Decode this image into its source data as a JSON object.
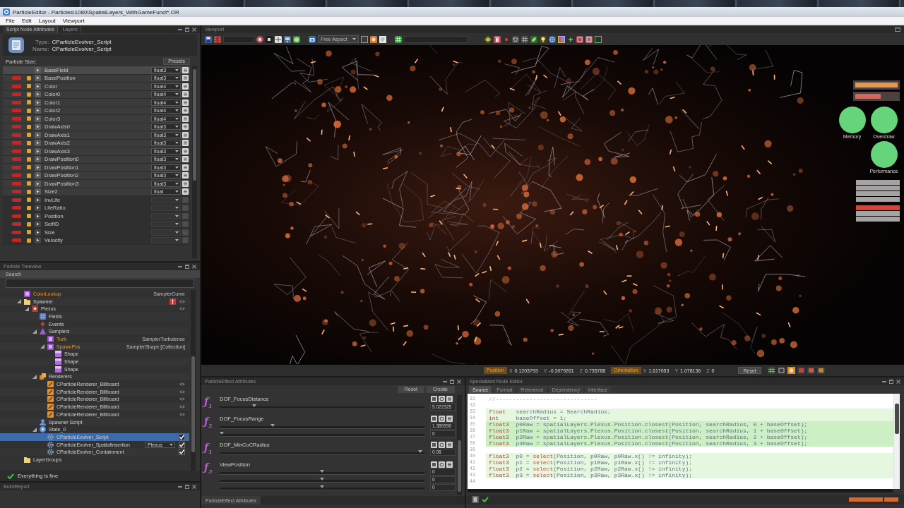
{
  "window": {
    "title": "ParticleEditor - Particles\\1080\\SpatialLayers_WithGameFunct*.OR"
  },
  "menu": [
    {
      "label": "File"
    },
    {
      "label": "Edit"
    },
    {
      "label": "Layout"
    },
    {
      "label": "Viewport"
    }
  ],
  "script_node_attributes": {
    "tabs": [
      {
        "label": "Script Node Attributes",
        "selected": true
      },
      {
        "label": "Layers",
        "selected": false
      }
    ],
    "type_label": "Type:",
    "type": "CParticleEvolver_Script",
    "name_label": "Name:",
    "name": "CParticleEvolver_Script",
    "size_label": "Particle Size:",
    "presets": "Presets",
    "fields": [
      {
        "name": "BaseField",
        "type": "float3",
        "selected": true,
        "editable": true,
        "marked": false
      },
      {
        "name": "BasePosition",
        "type": "float3",
        "selected": false,
        "editable": true,
        "marked": true
      },
      {
        "name": "Color",
        "type": "float4",
        "selected": false,
        "editable": true,
        "marked": true
      },
      {
        "name": "Color0",
        "type": "float4",
        "selected": false,
        "editable": true,
        "marked": true
      },
      {
        "name": "Color1",
        "type": "float4",
        "selected": false,
        "editable": true,
        "marked": true
      },
      {
        "name": "Color2",
        "type": "float4",
        "selected": false,
        "editable": true,
        "marked": true
      },
      {
        "name": "Color3",
        "type": "float4",
        "selected": false,
        "editable": true,
        "marked": true
      },
      {
        "name": "DrawAxis0",
        "type": "float3",
        "selected": false,
        "editable": true,
        "marked": true
      },
      {
        "name": "DrawAxis1",
        "type": "float3",
        "selected": false,
        "editable": true,
        "marked": true
      },
      {
        "name": "DrawAxis2",
        "type": "float3",
        "selected": false,
        "editable": true,
        "marked": true
      },
      {
        "name": "DrawAxis3",
        "type": "float3",
        "selected": false,
        "editable": true,
        "marked": true
      },
      {
        "name": "DrawPosition0",
        "type": "float3",
        "selected": false,
        "editable": true,
        "marked": true
      },
      {
        "name": "DrawPosition1",
        "type": "float3",
        "selected": false,
        "editable": true,
        "marked": true
      },
      {
        "name": "DrawPosition2",
        "type": "float3",
        "selected": false,
        "editable": true,
        "marked": true
      },
      {
        "name": "DrawPosition3",
        "type": "float3",
        "selected": false,
        "editable": true,
        "marked": true
      },
      {
        "name": "Size2",
        "type": "float",
        "selected": false,
        "editable": true,
        "marked": true
      },
      {
        "name": "InvLife",
        "selected": false,
        "editable": false,
        "marked": true
      },
      {
        "name": "LifeRatio",
        "selected": false,
        "editable": false,
        "marked": true
      },
      {
        "name": "Position",
        "selected": false,
        "editable": false,
        "marked": true
      },
      {
        "name": "SelfID",
        "selected": false,
        "editable": false,
        "marked": true
      },
      {
        "name": "Size",
        "selected": false,
        "editable": false,
        "marked": true
      },
      {
        "name": "Velocity",
        "selected": false,
        "editable": false,
        "marked": true
      }
    ]
  },
  "treeview": {
    "title": "Particle Treeview",
    "search_label": "Search",
    "nodes": [
      {
        "label": "ColorLookup",
        "kind": "sampler",
        "accent": true,
        "type": "SamplerCurve",
        "selected": false
      },
      {
        "label": "Spawner",
        "kind": "layer",
        "selected": false,
        "expanded": true,
        "alert": true,
        "toggle": true,
        "children": [
          {
            "label": "Plexus",
            "kind": "emitter",
            "selected": false,
            "expanded": true,
            "toggle": true,
            "children": [
              {
                "label": "Fields",
                "kind": "fields",
                "selected": false
              },
              {
                "label": "Events",
                "kind": "events",
                "selected": false
              },
              {
                "label": "Samplers",
                "kind": "samplers",
                "selected": false,
                "expanded": true,
                "children": [
                  {
                    "label": "Turb",
                    "kind": "sampler",
                    "accent": true,
                    "type": "SamplerTurbulence",
                    "selected": false
                  },
                  {
                    "label": "SpawnPos",
                    "kind": "sampler",
                    "accent": true,
                    "type": "SamplerShape [Collection]",
                    "selected": false,
                    "expanded": true,
                    "children": [
                      {
                        "label": "Shape",
                        "kind": "shape",
                        "selected": false
                      },
                      {
                        "label": "Shape",
                        "kind": "shape",
                        "selected": false
                      },
                      {
                        "label": "Shape",
                        "kind": "shape",
                        "selected": false
                      }
                    ]
                  }
                ]
              },
              {
                "label": "Renderers",
                "kind": "renderers",
                "selected": false,
                "expanded": true,
                "children": [
                  {
                    "label": "CParticleRenderer_Billboard",
                    "kind": "renderer",
                    "selected": false,
                    "toggle": true
                  },
                  {
                    "label": "CParticleRenderer_Billboard",
                    "kind": "renderer",
                    "selected": false,
                    "toggle": true
                  },
                  {
                    "label": "CParticleRenderer_Billboard",
                    "kind": "renderer",
                    "selected": false,
                    "toggle": true
                  },
                  {
                    "label": "CParticleRenderer_Billboard",
                    "kind": "renderer",
                    "selected": false,
                    "toggle": true
                  },
                  {
                    "label": "CParticleRenderer_Billboard",
                    "kind": "renderer",
                    "selected": false,
                    "toggle": true
                  }
                ]
              },
              {
                "label": "Spawner Script",
                "kind": "script",
                "selected": false
              },
              {
                "label": "State_0",
                "kind": "state",
                "selected": false,
                "expanded": true,
                "children": [
                  {
                    "label": "CParticleEvolver_Script",
                    "kind": "evolver",
                    "selected": true,
                    "checked": true
                  },
                  {
                    "label": "CParticleEvolver_SpatialInsertion",
                    "kind": "evolver",
                    "selected": false,
                    "checked": true,
                    "option": "Plexus"
                  },
                  {
                    "label": "CParticleEvolver_Containment",
                    "kind": "evolver",
                    "selected": false,
                    "checked": true
                  }
                ]
              }
            ]
          }
        ]
      },
      {
        "label": "LayerGroups",
        "kind": "layer",
        "selected": false
      }
    ],
    "status": {
      "ok": true,
      "text": "Everything is fine"
    }
  },
  "build_report": {
    "title": "BuildReport"
  },
  "viewport": {
    "title": "Viewport",
    "aspect": "Free Aspect",
    "hud": {
      "meters": [
        {
          "color": "#e39a4f",
          "level": 1
        },
        {
          "color": "#d9655a",
          "level": 0.6
        }
      ],
      "gauges": [
        {
          "label": "Memory"
        },
        {
          "label": "Overdraw"
        },
        {
          "label": "Performance"
        }
      ],
      "indicators": [
        {
          "alert": false
        },
        {
          "alert": false
        },
        {
          "alert": false
        },
        {
          "alert": false
        },
        {
          "alert": true
        },
        {
          "alert": false
        },
        {
          "alert": false
        }
      ]
    },
    "position_label": "Position",
    "position": [
      {
        "axis": "X",
        "value": "0.1203793"
      },
      {
        "axis": "Y",
        "value": "-0.3079261"
      },
      {
        "axis": "Z",
        "value": "0.735788"
      }
    ],
    "orientation_label": "Orientation",
    "orientation": [
      {
        "axis": "X",
        "value": "1.617053"
      },
      {
        "axis": "Y",
        "value": "1.078136"
      },
      {
        "axis": "Z",
        "value": "0"
      }
    ],
    "reset": "Reset",
    "view_modes": [
      {
        "selected": false
      },
      {
        "selected": false
      },
      {
        "selected": true
      },
      {
        "selected": false
      },
      {
        "selected": false
      },
      {
        "selected": false
      }
    ]
  },
  "effect_attributes": {
    "title": "ParticleEffect Attributes",
    "buttons": [
      {
        "label": "Reset"
      },
      {
        "label": "Create"
      }
    ],
    "attributes": [
      {
        "icon_text": "ƒ$_{1}$",
        "name": "DOF_FocusDistance",
        "sliders": [
          {
            "level": 0.17,
            "value": "5.022325"
          }
        ]
      },
      {
        "icon_text": "ƒ$_{2}$",
        "name": "DOF_FocusRange",
        "sliders": [
          {
            "level": 0.26,
            "value": "1.389390"
          },
          {
            "level": 0.01,
            "value": "0"
          }
        ]
      },
      {
        "icon_text": "ƒ$_{1}$",
        "name": "DOF_MinCoCRadius",
        "sliders": [
          {
            "level": 0.98,
            "value": "0.08"
          }
        ]
      },
      {
        "icon_text": "ƒ$_{3}$",
        "name": "ViewPosition",
        "sliders": [
          {
            "level": 0.5,
            "value": "0"
          },
          {
            "level": 0.5,
            "value": "0"
          },
          {
            "level": 0.5,
            "value": "0"
          }
        ]
      }
    ],
    "tabs": [
      {
        "label": "ParticleEffect Attributes",
        "selected": true
      }
    ]
  },
  "node_editor": {
    "title": "Specialized Node Editor",
    "tabs": [
      {
        "label": "Source",
        "selected": true
      },
      {
        "label": "Format",
        "selected": false
      },
      {
        "label": "Reference",
        "selected": false
      },
      {
        "label": "Dependency",
        "selected": false
      },
      {
        "label": "Interface",
        "selected": false
      }
    ],
    "code": [
      {
        "number": "31",
        "tokens": [
          {
            "kind": "comment",
            "text": "//------------------------------"
          }
        ]
      },
      {
        "number": "32"
      },
      {
        "number": "33",
        "color": "#e6f7df",
        "tokens": [
          {
            "kind": "keyword",
            "text": "float"
          },
          {
            "kind": "plain",
            "text": "   searchRadius = SearchRadius;"
          }
        ]
      },
      {
        "number": "34",
        "color": "#e6f7df",
        "tokens": [
          {
            "kind": "keyword",
            "text": "int"
          },
          {
            "kind": "plain",
            "text": "     baseOffset = 1;"
          }
        ]
      },
      {
        "number": "35",
        "color": "#cdefc4",
        "tokens": [
          {
            "kind": "keyword",
            "text": "float3"
          },
          {
            "kind": "plain",
            "text": "  p0Raw = spatialLayers.Plexus.Position.closest(Position, searchRadius, 0 + baseOffset);"
          }
        ]
      },
      {
        "number": "36",
        "color": "#cdefc4",
        "tokens": [
          {
            "kind": "keyword",
            "text": "float3"
          },
          {
            "kind": "plain",
            "text": "  p1Raw = spatialLayers.Plexus.Position.closest(Position, searchRadius, 1 + baseOffset);"
          }
        ]
      },
      {
        "number": "37",
        "color": "#cdefc4",
        "tokens": [
          {
            "kind": "keyword",
            "text": "float3"
          },
          {
            "kind": "plain",
            "text": "  p2Raw = spatialLayers.Plexus.Position.closest(Position, searchRadius, 2 + baseOffset);"
          }
        ]
      },
      {
        "number": "38",
        "color": "#cdefc4",
        "tokens": [
          {
            "kind": "keyword",
            "text": "float3"
          },
          {
            "kind": "plain",
            "text": "  p3Raw = spatialLayers.Plexus.Position.closest(Position, searchRadius, 3 + baseOffset);"
          }
        ]
      },
      {
        "number": "39"
      },
      {
        "number": "40",
        "color": "#e6f7df",
        "tokens": [
          {
            "kind": "keyword",
            "text": "float3"
          },
          {
            "kind": "plain",
            "text": "  p0 = "
          },
          {
            "kind": "function",
            "text": "select"
          },
          {
            "kind": "plain",
            "text": "(Position, p0Raw, p0Raw.x() != infinity);"
          }
        ]
      },
      {
        "number": "41",
        "color": "#e6f7df",
        "tokens": [
          {
            "kind": "keyword",
            "text": "float3"
          },
          {
            "kind": "plain",
            "text": "  p1 = "
          },
          {
            "kind": "function",
            "text": "select"
          },
          {
            "kind": "plain",
            "text": "(Position, p1Raw, p1Raw.x() != infinity);"
          }
        ]
      },
      {
        "number": "42",
        "color": "#e6f7df",
        "tokens": [
          {
            "kind": "keyword",
            "text": "float3"
          },
          {
            "kind": "plain",
            "text": "  p2 = "
          },
          {
            "kind": "function",
            "text": "select"
          },
          {
            "kind": "plain",
            "text": "(Position, p2Raw, p2Raw.x() != infinity);"
          }
        ]
      },
      {
        "number": "43",
        "color": "#e6f7df",
        "tokens": [
          {
            "kind": "keyword",
            "text": "float3"
          },
          {
            "kind": "plain",
            "text": "  p3 = "
          },
          {
            "kind": "function",
            "text": "select"
          },
          {
            "kind": "plain",
            "text": "(Position, p3Raw, p3Raw.x() != infinity);"
          }
        ]
      },
      {
        "number": "44"
      }
    ],
    "status": {
      "ok": true
    }
  }
}
